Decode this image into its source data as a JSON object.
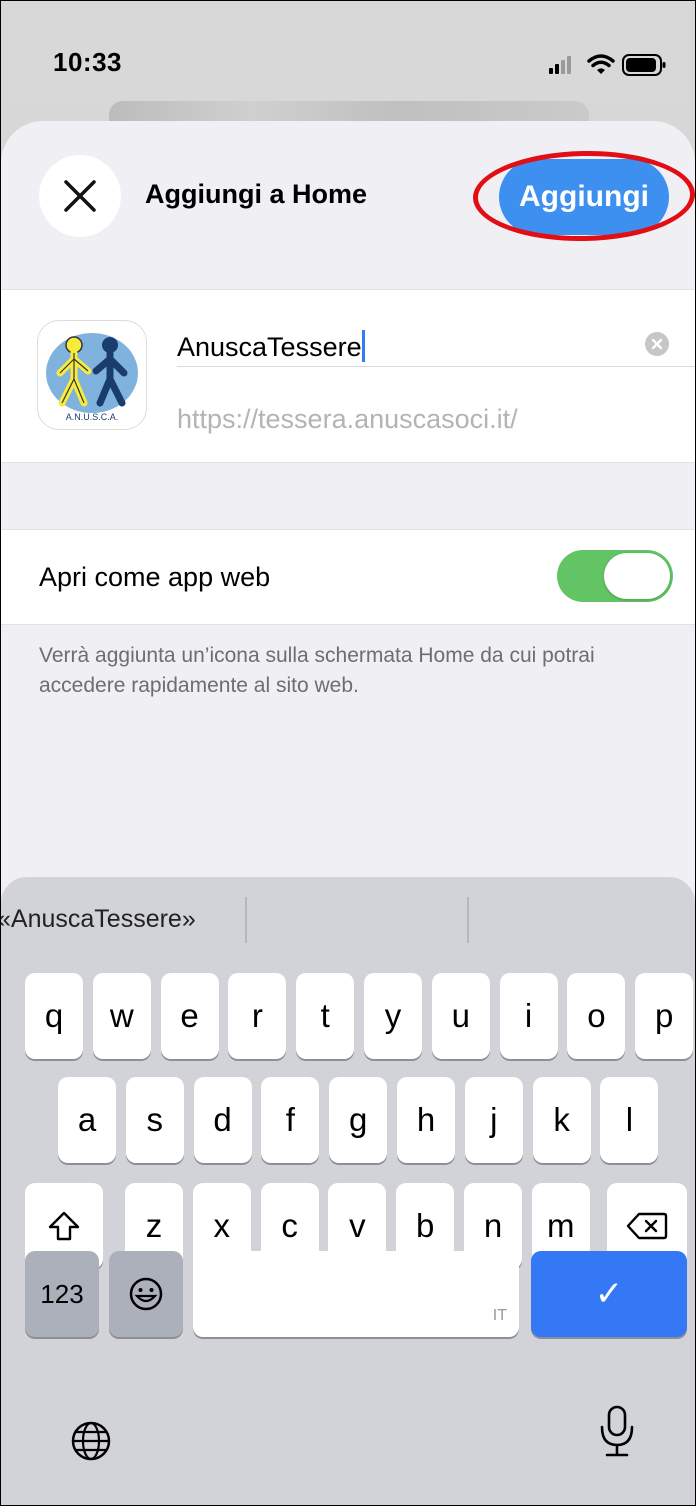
{
  "status_bar": {
    "time": "10:33"
  },
  "sheet": {
    "title": "Aggiungi a Home",
    "add_label": "Aggiungi",
    "app_name": "AnuscaTessere",
    "url": "https://tessera.anuscasoci.it/",
    "icon_text": "A.N.U.S.C.A."
  },
  "webapp": {
    "label": "Apri come app web",
    "enabled": true,
    "footnote": "Verrà aggiunta un’icona sulla schermata Home da cui potrai accedere rapidamente al sito web."
  },
  "keyboard": {
    "suggestion": "«AnuscaTessere»",
    "row1": [
      "q",
      "w",
      "e",
      "r",
      "t",
      "y",
      "u",
      "i",
      "o",
      "p"
    ],
    "row2": [
      "a",
      "s",
      "d",
      "f",
      "g",
      "h",
      "j",
      "k",
      "l"
    ],
    "row3": [
      "z",
      "x",
      "c",
      "v",
      "b",
      "n",
      "m"
    ],
    "numbers_label": "123",
    "space_lang": "IT",
    "return_symbol": "✓"
  },
  "colors": {
    "accent": "#3d8ff0",
    "toggle_on": "#63c466",
    "highlight": "#e10e14",
    "keyboard_bg": "#d1d3d9"
  }
}
